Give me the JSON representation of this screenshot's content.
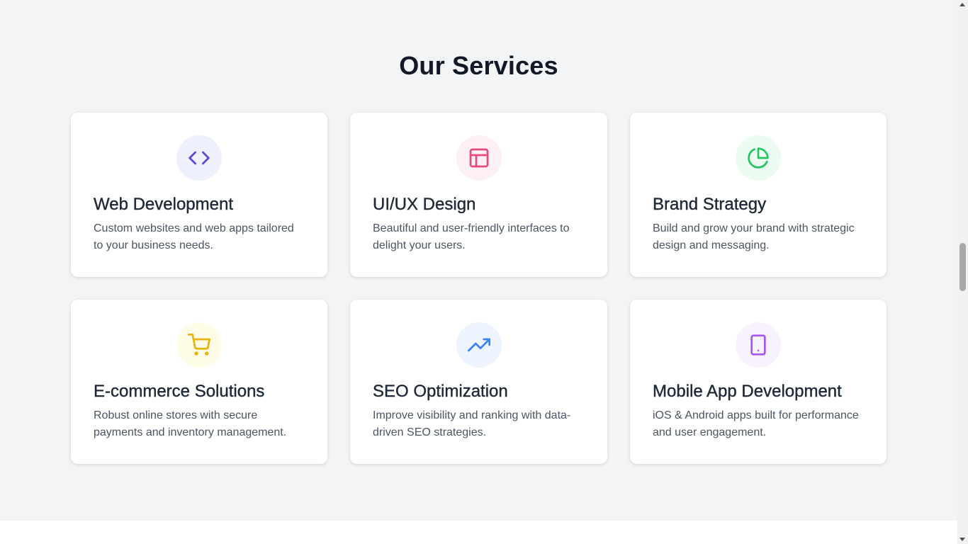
{
  "section": {
    "title": "Our Services"
  },
  "cards": [
    {
      "icon": "code-icon",
      "icon_bg": "#eef0fc",
      "icon_color": "#5b45d6",
      "title": "Web Development",
      "desc": "Custom websites and web apps tailored to your business needs."
    },
    {
      "icon": "layout-icon",
      "icon_bg": "#fdf0f5",
      "icon_color": "#e5497f",
      "title": "UI/UX Design",
      "desc": "Beautiful and user-friendly interfaces to delight your users."
    },
    {
      "icon": "pie-chart-icon",
      "icon_bg": "#ecfbf1",
      "icon_color": "#22c55e",
      "title": "Brand Strategy",
      "desc": "Build and grow your brand with strategic design and messaging."
    },
    {
      "icon": "shopping-cart-icon",
      "icon_bg": "#fefbe6",
      "icon_color": "#eab308",
      "title": "E-commerce Solutions",
      "desc": "Robust online stores with secure payments and inventory management."
    },
    {
      "icon": "trending-up-icon",
      "icon_bg": "#eef4fe",
      "icon_color": "#3b82f6",
      "title": "SEO Optimization",
      "desc": "Improve visibility and ranking with data-driven SEO strategies."
    },
    {
      "icon": "tablet-icon",
      "icon_bg": "#f8f1fe",
      "icon_color": "#a855f7",
      "title": "Mobile App Development",
      "desc": "iOS & Android apps built for performance and user engagement."
    }
  ]
}
